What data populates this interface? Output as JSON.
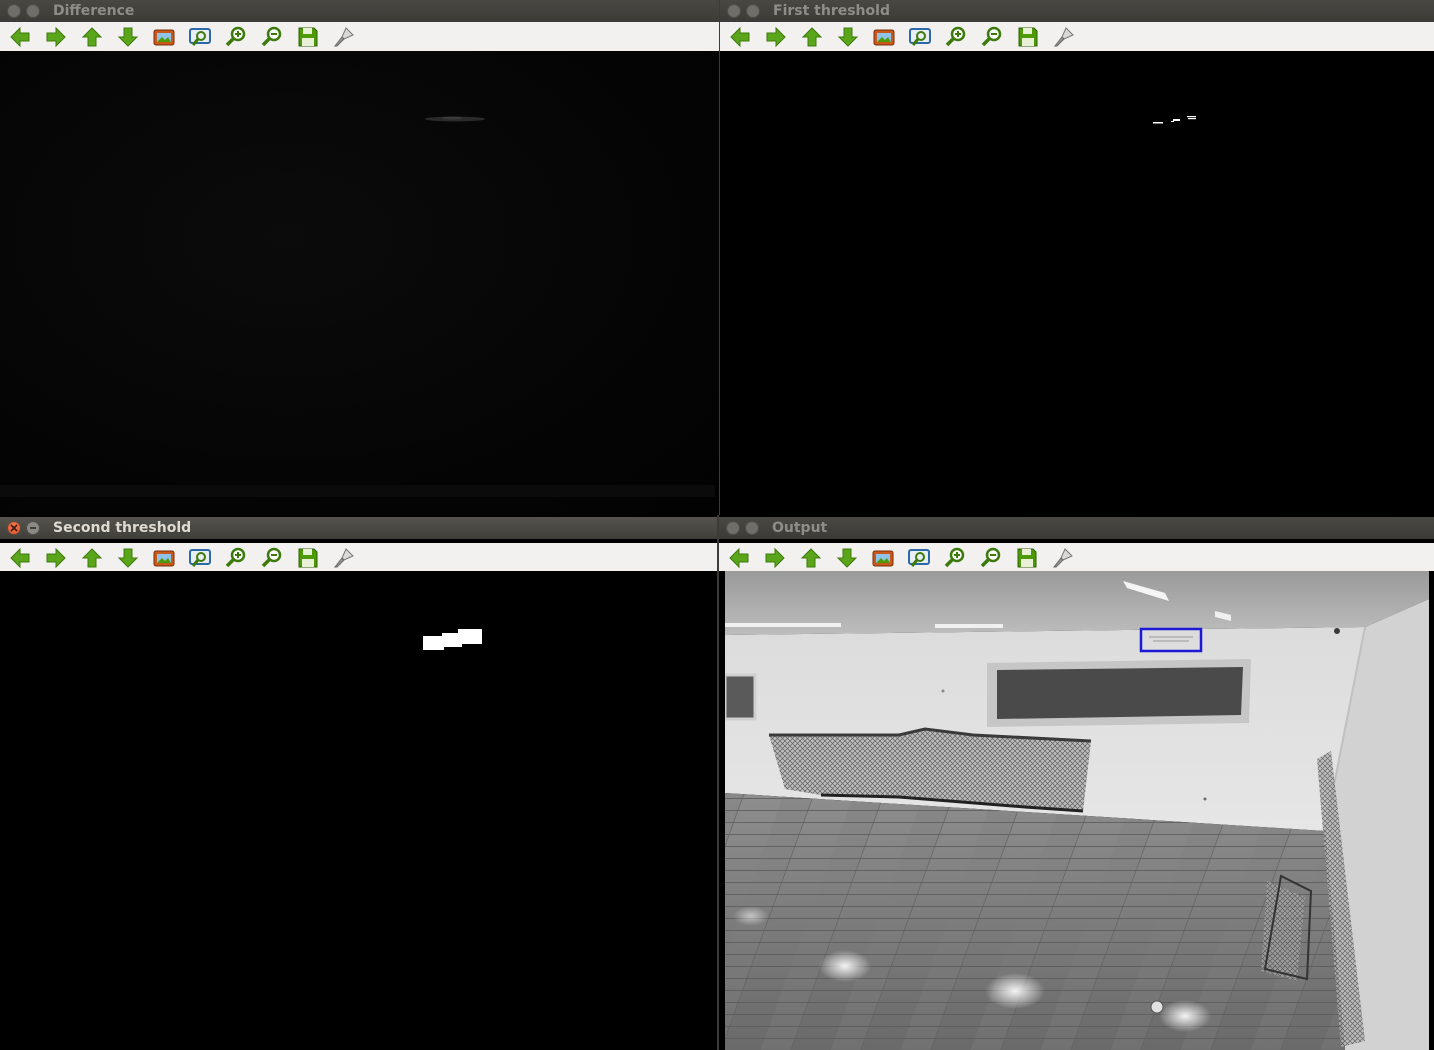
{
  "windows": [
    {
      "title": "Difference",
      "active": false
    },
    {
      "title": "First threshold",
      "active": false
    },
    {
      "title": "Second threshold",
      "active": true
    },
    {
      "title": "Output",
      "active": false
    }
  ],
  "toolbar": {
    "buttons": [
      "pan-left-icon",
      "pan-right-icon",
      "pan-up-icon",
      "pan-down-icon",
      "reset-zoom-icon",
      "zoom-region-icon",
      "zoom-in-icon",
      "zoom-out-icon",
      "save-icon",
      "properties-icon"
    ]
  },
  "colors": {
    "title_active": "#dfdbd2",
    "title_inactive": "#8f8d87",
    "close_button": "#df4a16",
    "arrow_green": "#4e9a06",
    "detection_box": "#1a1ad6"
  }
}
